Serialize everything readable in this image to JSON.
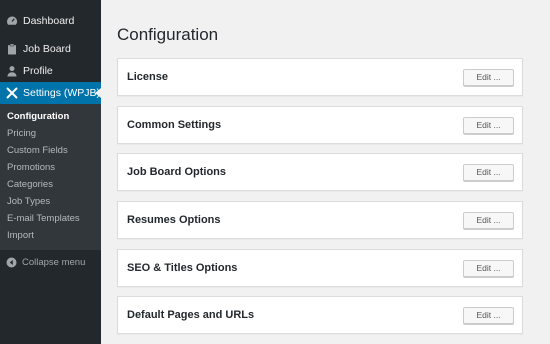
{
  "sidebar": {
    "items": [
      {
        "label": "Dashboard",
        "icon": "dashboard-icon"
      },
      {
        "label": "Job Board",
        "icon": "clipboard-icon"
      },
      {
        "label": "Profile",
        "icon": "user-icon"
      },
      {
        "label": "Settings (WPJB)",
        "icon": "tools-icon",
        "active": true
      }
    ],
    "submenu": [
      {
        "label": "Configuration",
        "current": true
      },
      {
        "label": "Pricing"
      },
      {
        "label": "Custom Fields"
      },
      {
        "label": "Promotions"
      },
      {
        "label": "Categories"
      },
      {
        "label": "Job Types"
      },
      {
        "label": "E-mail Templates"
      },
      {
        "label": "Import"
      }
    ],
    "collapse_label": "Collapse menu"
  },
  "main": {
    "title": "Configuration",
    "panels": [
      {
        "label": "License",
        "button": "Edit ..."
      },
      {
        "label": "Common Settings",
        "button": "Edit ..."
      },
      {
        "label": "Job Board Options",
        "button": "Edit ..."
      },
      {
        "label": "Resumes Options",
        "button": "Edit ..."
      },
      {
        "label": "SEO & Titles Options",
        "button": "Edit ..."
      },
      {
        "label": "Default Pages and URLs",
        "button": "Edit ..."
      }
    ]
  },
  "colors": {
    "sidebar_bg": "#23282d",
    "submenu_bg": "#32373c",
    "accent": "#0073aa",
    "content_bg": "#f1f1f1"
  }
}
